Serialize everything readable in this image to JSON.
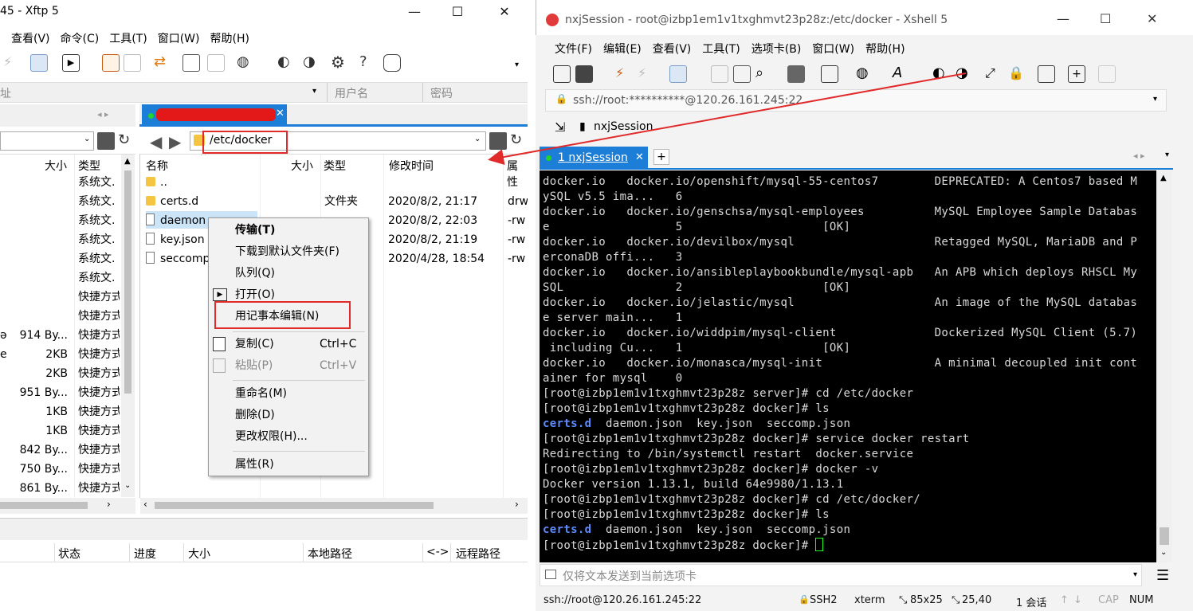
{
  "xftp": {
    "title": "45   - Xftp 5",
    "menu": [
      "查看(V)",
      "命令(C)",
      "工具(T)",
      "窗口(W)",
      "帮助(H)"
    ],
    "address_row": {
      "host_label": "址",
      "user_placeholder": "用户名",
      "password_placeholder": "密码"
    },
    "left_panel": {
      "columns": {
        "size": "大小",
        "type": "类型"
      },
      "rows": [
        {
          "size": "",
          "type": "系统文."
        },
        {
          "size": "",
          "type": "系统文."
        },
        {
          "size": "",
          "type": "系统文."
        },
        {
          "size": "",
          "type": "系统文."
        },
        {
          "size": "",
          "type": "系统文."
        },
        {
          "size": "",
          "type": "系统文."
        },
        {
          "size": "",
          "type": "快捷方式"
        },
        {
          "size": "",
          "type": "快捷方式"
        },
        {
          "name": "ə",
          "size": "914 By...",
          "type": "快捷方式"
        },
        {
          "name": "e",
          "size": "2KB",
          "type": "快捷方式"
        },
        {
          "name": "",
          "size": "2KB",
          "type": "快捷方式"
        },
        {
          "name": "",
          "size": "951 By...",
          "type": "快捷方式"
        },
        {
          "size": "1KB",
          "type": "快捷方式"
        },
        {
          "size": "1KB",
          "type": "快捷方式"
        },
        {
          "size": "842 By...",
          "type": "快捷方式"
        },
        {
          "size": "750 By...",
          "type": "快捷方式"
        },
        {
          "size": "861 By...",
          "type": "快捷方式"
        }
      ]
    },
    "right_panel": {
      "path": "/etc/docker",
      "columns": {
        "name": "名称",
        "size": "大小",
        "type": "类型",
        "mtime": "修改时间",
        "perm": "属性"
      },
      "rows": [
        {
          "name": "..",
          "size": "",
          "type": "",
          "mtime": "",
          "perm": ""
        },
        {
          "name": "certs.d",
          "size": "",
          "type": "文件夹",
          "mtime": "2020/8/2, 21:17",
          "perm": "drw"
        },
        {
          "name": "daemon",
          "size": "",
          "type": "",
          "mtime": "2020/8/2, 22:03",
          "perm": "-rw"
        },
        {
          "name": "key.json",
          "size": "",
          "type": "",
          "mtime": "2020/8/2, 21:19",
          "perm": "-rw"
        },
        {
          "name": "seccomp",
          "size": "",
          "type": "",
          "mtime": "2020/4/28, 18:54",
          "perm": "-rw"
        }
      ]
    },
    "transfer_columns": [
      "状态",
      "进度",
      "大小",
      "本地路径",
      "<->",
      "远程路径"
    ],
    "context_menu": {
      "transfer": "传输(T)",
      "download_default": "下载到默认文件夹(F)",
      "queue": "队列(Q)",
      "open": "打开(O)",
      "edit_notepad": "用记事本编辑(N)",
      "copy": "复制(C)",
      "copy_shortcut": "Ctrl+C",
      "paste": "粘贴(P)",
      "paste_shortcut": "Ctrl+V",
      "rename": "重命名(M)",
      "delete": "删除(D)",
      "chmod": "更改权限(H)...",
      "properties": "属性(R)"
    }
  },
  "xshell": {
    "title": "nxjSession - root@izbp1em1v1txghmvt23p28z:/etc/docker - Xshell 5",
    "menu": [
      "文件(F)",
      "编辑(E)",
      "查看(V)",
      "工具(T)",
      "选项卡(B)",
      "窗口(W)",
      "帮助(H)"
    ],
    "address": "ssh://root:**********@120.26.161.245:22",
    "session_link": "nxjSession",
    "tab": "1 nxjSession",
    "terminal_lines": [
      {
        "text": "docker.io   docker.io/openshift/mysql-55-centos7        DEPRECATED: A Centos7 based M"
      },
      {
        "text": "ySQL v5.5 ima...   6"
      },
      {
        "text": "docker.io   docker.io/genschsa/mysql-employees          MySQL Employee Sample Databas"
      },
      {
        "text": "e                  5                    [OK]"
      },
      {
        "text": "docker.io   docker.io/devilbox/mysql                    Retagged MySQL, MariaDB and P"
      },
      {
        "text": "erconaDB offi...   3"
      },
      {
        "text": "docker.io   docker.io/ansibleplaybookbundle/mysql-apb   An APB which deploys RHSCL My"
      },
      {
        "text": "SQL                2                    [OK]"
      },
      {
        "text": "docker.io   docker.io/jelastic/mysql                    An image of the MySQL databas"
      },
      {
        "text": "e server main...   1"
      },
      {
        "text": "docker.io   docker.io/widdpim/mysql-client              Dockerized MySQL Client (5.7)"
      },
      {
        "text": " including Cu...   1                    [OK]"
      },
      {
        "text": "docker.io   docker.io/monasca/mysql-init                A minimal decoupled init cont"
      },
      {
        "text": "ainer for mysql    0"
      },
      {
        "text": "[root@izbp1em1v1txghmvt23p28z server]# cd /etc/docker"
      },
      {
        "text": "[root@izbp1em1v1txghmvt23p28z docker]# ls"
      },
      {
        "ls": true,
        "dir": "certs.d",
        "text": "  daemon.json  key.json  seccomp.json"
      },
      {
        "text": "[root@izbp1em1v1txghmvt23p28z docker]# service docker restart"
      },
      {
        "text": "Redirecting to /bin/systemctl restart  docker.service"
      },
      {
        "text": "[root@izbp1em1v1txghmvt23p28z docker]# docker -v"
      },
      {
        "text": "Docker version 1.13.1, build 64e9980/1.13.1"
      },
      {
        "text": "[root@izbp1em1v1txghmvt23p28z docker]# cd /etc/docker/"
      },
      {
        "text": "[root@izbp1em1v1txghmvt23p28z docker]# ls"
      },
      {
        "ls": true,
        "dir": "certs.d",
        "text": "  daemon.json  key.json  seccomp.json"
      },
      {
        "text": "[root@izbp1em1v1txghmvt23p28z docker]# "
      }
    ],
    "send_placeholder": "仅将文本发送到当前选项卡",
    "status": {
      "conn": "ssh://root@120.26.161.245:22",
      "proto": "SSH2",
      "term": "xterm",
      "size": "85x25",
      "pos": "25,40",
      "sessions": "1 会话",
      "cap": "CAP",
      "num": "NUM"
    }
  }
}
